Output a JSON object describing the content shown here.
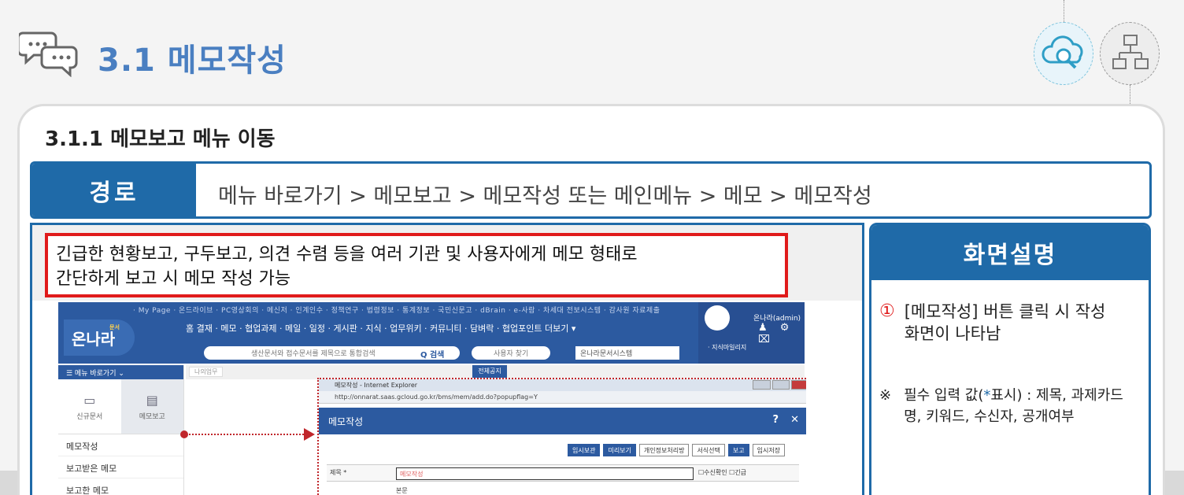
{
  "header": {
    "title": "3.1 메모작성",
    "chat_icon": "chat-bubbles-icon",
    "search_icon": "cloud-search-icon",
    "org_icon": "org-chart-icon"
  },
  "section": {
    "title": "3.1.1 메모보고 메뉴 이동"
  },
  "path": {
    "label": "경로",
    "text": "메뉴 바로가기 > 메모보고 > 메모작성 또는 메인메뉴 > 메모 > 메모작성"
  },
  "description": {
    "line1": "긴급한 현황보고, 구두보고, 의견 수렴 등을 여러 기관 및 사용자에게 메모 형태로",
    "line2": "간단하게 보고 시 메모 작성 가능"
  },
  "screen_desc": {
    "title": "화면설명",
    "note1_num": "①",
    "note1_text": "[메모작성] 버튼 클릭 시 작성 화면이 나타남",
    "note2_mark": "※",
    "note2_pre": "필수 입력 값(",
    "note2_asterisk": "*",
    "note2_post": "표시) : 제목, 과제카드명, 키워드, 수신자, 공개여부"
  },
  "screenshot": {
    "top_links": "· My Page · 온드라이브 · PC영상회의 · 메신저 · 인계인수 · 정책연구 · 법령정보 · 통계정보 · 국민신문고 · dBrain · e-사람 · 차세대 전보시스템 · 감사원 자료제출",
    "logo": "온나라",
    "logo_sub": "문서",
    "main_menu": "홈  결재 · 메모 · 협업과제 · 메일 · 일정 · 게시판 · 지식 · 업무위키 · 커뮤니티 · 담벼락 · 협업포인트   더보기 ▾",
    "search_placeholder": "생산문서와 접수문서를 제목으로 통합검색",
    "search_button": "Q 검색",
    "person_search": "사용자 찾기",
    "doc_select": "온나라문서시스템",
    "user_name": "온나라(admin)",
    "icons": "♟ ⚙ ⌧",
    "knowledge": "· 지식마일리지",
    "sidebar_head": "☰   메뉴 바로가기         ⌄",
    "tab_draft": "신규문서",
    "tab_memo": "메모보고",
    "side_items": [
      "메모작성",
      "보고받은 메모",
      "보고한 메모"
    ],
    "tab_mini": "나의업무",
    "tab_blue": "전체공지",
    "popup_title": "메모작성 - Internet Explorer",
    "popup_url": "http://onnarat.saas.gcloud.go.kr/bms/mem/add.do?popupflag=Y",
    "memo_header": "메모작성",
    "help": "?",
    "close": "✕",
    "buttons": [
      "임시보관",
      "미리보기",
      "개인정보처리방",
      "서식선택",
      "보고",
      "임시저장"
    ],
    "form_label": "제목 *",
    "form_value": "메모작성",
    "checks": "☐수신확인  ☐긴급",
    "form_label2": "본문"
  }
}
